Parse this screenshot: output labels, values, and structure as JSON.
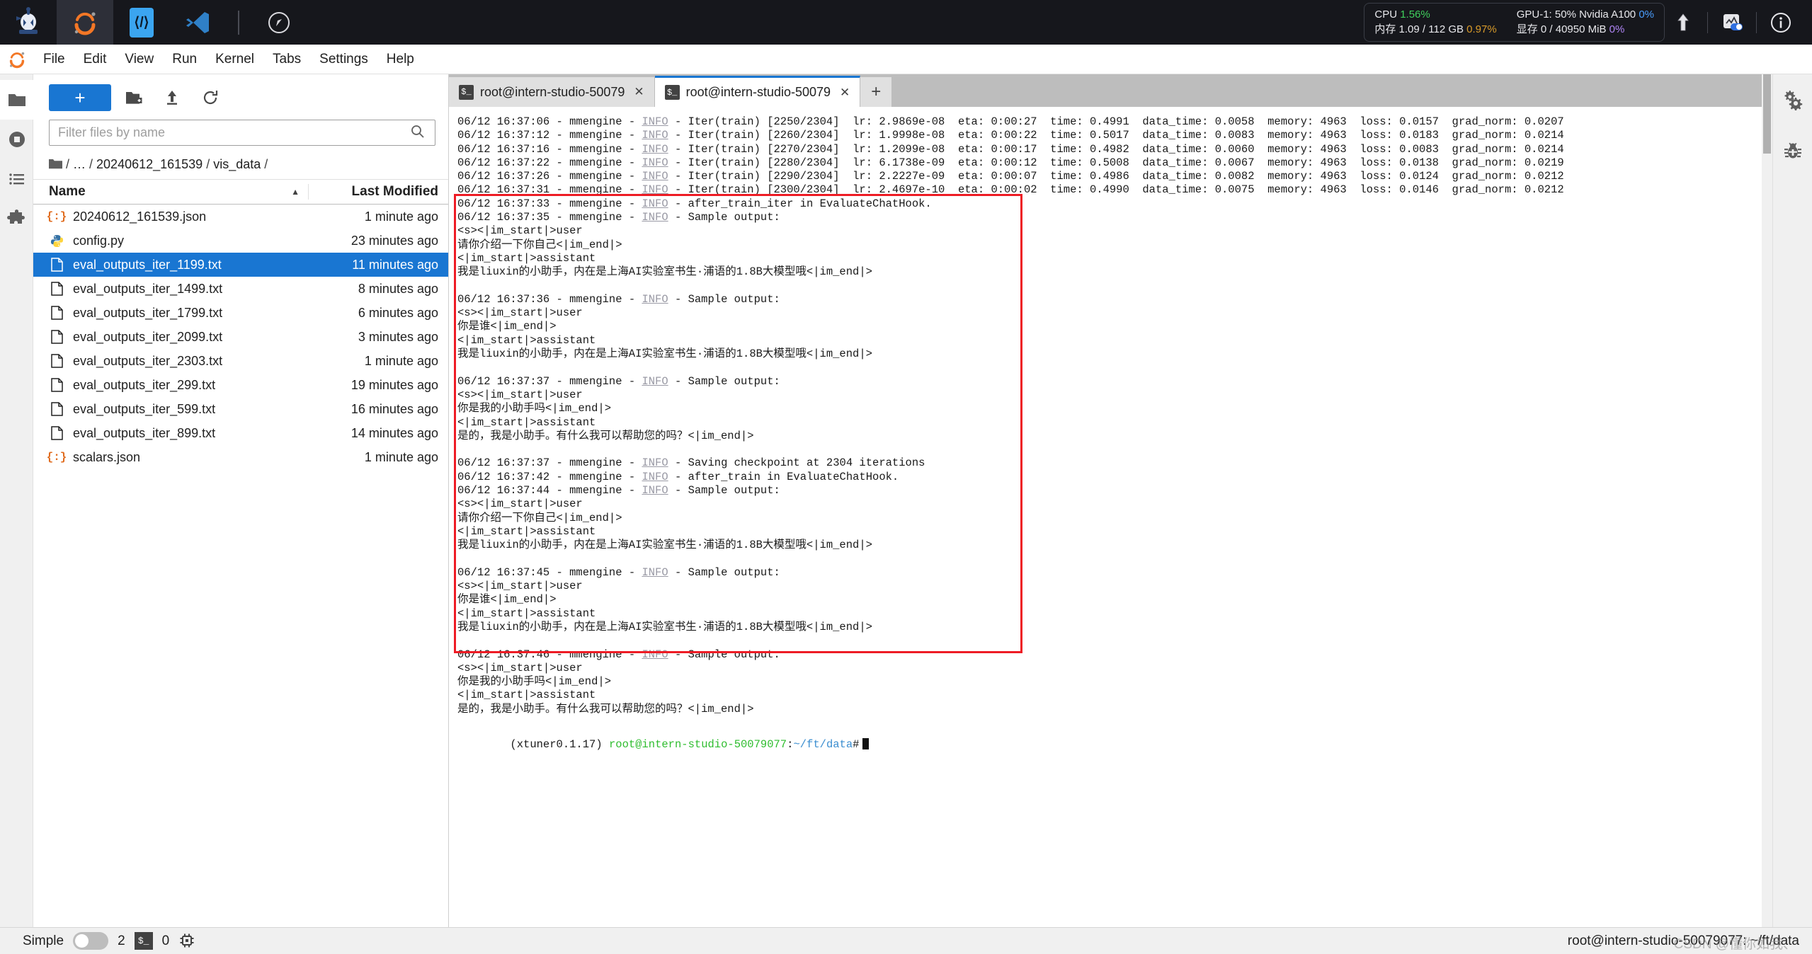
{
  "topbar": {
    "icons": [
      "robot-logo",
      "jupyter-logo",
      "code-server-icon",
      "vscode-icon",
      "compass-icon"
    ],
    "stats": {
      "cpu_label": "CPU",
      "cpu_value": "1.56%",
      "mem_label": "内存",
      "mem_value": "1.09 / 112 GB",
      "mem_pct": "0.97%",
      "gpu_label": "GPU-1: 50% Nvidia A100",
      "gpu_pct": "0%",
      "vram_label": "显存",
      "vram_value": "0 / 40950 MiB",
      "vram_pct": "0%"
    },
    "right_icons": [
      "upload-arrow-icon",
      "monitor-toggle-icon",
      "info-icon"
    ],
    "colors": {
      "green": "#3fcf5c",
      "orange": "#d99b2a",
      "blue": "#4a9eff",
      "purple": "#b085f5",
      "bar_bg": "#16171c"
    }
  },
  "menubar": {
    "items": [
      "File",
      "Edit",
      "View",
      "Run",
      "Kernel",
      "Tabs",
      "Settings",
      "Help"
    ]
  },
  "left_rail": {
    "items": [
      {
        "name": "file-browser",
        "icon": "folder-icon",
        "active": true
      },
      {
        "name": "running-sessions",
        "icon": "stop-circle-icon",
        "active": false
      },
      {
        "name": "table-of-contents",
        "icon": "list-icon",
        "active": false
      },
      {
        "name": "extensions",
        "icon": "puzzle-icon",
        "active": false
      }
    ]
  },
  "right_rail": {
    "items": [
      {
        "name": "property-inspector",
        "icon": "gears-icon"
      },
      {
        "name": "debugger",
        "icon": "bug-icon"
      }
    ]
  },
  "browser": {
    "new_launcher_label": "+",
    "toolbar_icons": [
      "new-folder-icon",
      "upload-icon",
      "refresh-icon"
    ],
    "filter_placeholder": "Filter files by name",
    "filter_value": "",
    "breadcrumb": [
      "/",
      "…",
      "/",
      "20240612_161539",
      "/",
      "vis_data",
      "/"
    ],
    "columns": {
      "name": "Name",
      "last_modified": "Last Modified"
    },
    "sort_indicator": "▲",
    "files": [
      {
        "name": "20240612_161539.json",
        "modified": "1 minute ago",
        "type": "json",
        "selected": false
      },
      {
        "name": "config.py",
        "modified": "23 minutes ago",
        "type": "python",
        "selected": false
      },
      {
        "name": "eval_outputs_iter_1199.txt",
        "modified": "11 minutes ago",
        "type": "text",
        "selected": true
      },
      {
        "name": "eval_outputs_iter_1499.txt",
        "modified": "8 minutes ago",
        "type": "text",
        "selected": false
      },
      {
        "name": "eval_outputs_iter_1799.txt",
        "modified": "6 minutes ago",
        "type": "text",
        "selected": false
      },
      {
        "name": "eval_outputs_iter_2099.txt",
        "modified": "3 minutes ago",
        "type": "text",
        "selected": false
      },
      {
        "name": "eval_outputs_iter_2303.txt",
        "modified": "1 minute ago",
        "type": "text",
        "selected": false
      },
      {
        "name": "eval_outputs_iter_299.txt",
        "modified": "19 minutes ago",
        "type": "text",
        "selected": false
      },
      {
        "name": "eval_outputs_iter_599.txt",
        "modified": "16 minutes ago",
        "type": "text",
        "selected": false
      },
      {
        "name": "eval_outputs_iter_899.txt",
        "modified": "14 minutes ago",
        "type": "text",
        "selected": false
      },
      {
        "name": "scalars.json",
        "modified": "1 minute ago",
        "type": "json",
        "selected": false
      }
    ]
  },
  "terminal_tabs": [
    {
      "label": "root@intern-studio-50079",
      "active": false
    },
    {
      "label": "root@intern-studio-50079",
      "active": true
    }
  ],
  "terminal_tab_add": "+",
  "terminal": {
    "log_lines": [
      "06/12 16:37:06 - mmengine - \u0001INFO\u0001 - Iter(train) [2250/2304]  lr: 2.9869e-08  eta: 0:00:27  time: 0.4991  data_time: 0.0058  memory: 4963  loss: 0.0157  grad_norm: 0.0207",
      "06/12 16:37:12 - mmengine - \u0001INFO\u0001 - Iter(train) [2260/2304]  lr: 1.9998e-08  eta: 0:00:22  time: 0.5017  data_time: 0.0083  memory: 4963  loss: 0.0183  grad_norm: 0.0214",
      "06/12 16:37:16 - mmengine - \u0001INFO\u0001 - Iter(train) [2270/2304]  lr: 1.2099e-08  eta: 0:00:17  time: 0.4982  data_time: 0.0060  memory: 4963  loss: 0.0083  grad_norm: 0.0214",
      "06/12 16:37:22 - mmengine - \u0001INFO\u0001 - Iter(train) [2280/2304]  lr: 6.1738e-09  eta: 0:00:12  time: 0.5008  data_time: 0.0067  memory: 4963  loss: 0.0138  grad_norm: 0.0219",
      "06/12 16:37:26 - mmengine - \u0001INFO\u0001 - Iter(train) [2290/2304]  lr: 2.2227e-09  eta: 0:00:07  time: 0.4986  data_time: 0.0082  memory: 4963  loss: 0.0124  grad_norm: 0.0212",
      "06/12 16:37:31 - mmengine - \u0001INFO\u0001 - Iter(train) [2300/2304]  lr: 2.4697e-10  eta: 0:00:02  time: 0.4990  data_time: 0.0075  memory: 4963  loss: 0.0146  grad_norm: 0.0212",
      "06/12 16:37:33 - mmengine - \u0001INFO\u0001 - after_train_iter in EvaluateChatHook.",
      "06/12 16:37:35 - mmengine - \u0001INFO\u0001 - Sample output:",
      "<s><|im_start|>user",
      "请你介绍一下你自己<|im_end|>",
      "<|im_start|>assistant",
      "我是liuxin的小助手，内在是上海AI实验室书生·浦语的1.8B大模型哦<|im_end|>",
      "",
      "06/12 16:37:36 - mmengine - \u0001INFO\u0001 - Sample output:",
      "<s><|im_start|>user",
      "你是谁<|im_end|>",
      "<|im_start|>assistant",
      "我是liuxin的小助手，内在是上海AI实验室书生·浦语的1.8B大模型哦<|im_end|>",
      "",
      "06/12 16:37:37 - mmengine - \u0001INFO\u0001 - Sample output:",
      "<s><|im_start|>user",
      "你是我的小助手吗<|im_end|>",
      "<|im_start|>assistant",
      "是的，我是小助手。有什么我可以帮助您的吗？<|im_end|>",
      "",
      "06/12 16:37:37 - mmengine - \u0001INFO\u0001 - Saving checkpoint at 2304 iterations",
      "06/12 16:37:42 - mmengine - \u0001INFO\u0001 - after_train in EvaluateChatHook.",
      "06/12 16:37:44 - mmengine - \u0001INFO\u0001 - Sample output:",
      "<s><|im_start|>user",
      "请你介绍一下你自己<|im_end|>",
      "<|im_start|>assistant",
      "我是liuxin的小助手，内在是上海AI实验室书生·浦语的1.8B大模型哦<|im_end|>",
      "",
      "06/12 16:37:45 - mmengine - \u0001INFO\u0001 - Sample output:",
      "<s><|im_start|>user",
      "你是谁<|im_end|>",
      "<|im_start|>assistant",
      "我是liuxin的小助手，内在是上海AI实验室书生·浦语的1.8B大模型哦<|im_end|>",
      "",
      "06/12 16:37:46 - mmengine - \u0001INFO\u0001 - Sample output:",
      "<s><|im_start|>user",
      "你是我的小助手吗<|im_end|>",
      "<|im_start|>assistant",
      "是的，我是小助手。有什么我可以帮助您的吗？<|im_end|>"
    ],
    "prompt": {
      "env": "(xtuner0.1.17)",
      "user_host": "root@intern-studio-50079077",
      "colon": ":",
      "path": "~/ft/data",
      "symbol": "#"
    },
    "annotation_box_color": "#ee1c25"
  },
  "statusbar": {
    "mode_label": "Simple",
    "mode_on": false,
    "kernel_count": "2",
    "terminal_icon": "$_",
    "terminal_count": "0",
    "cpu_icon": "chip-icon",
    "right_text": "root@intern-studio-50079077: ~/ft/data",
    "watermark": "CSDN @懂你如我、"
  }
}
